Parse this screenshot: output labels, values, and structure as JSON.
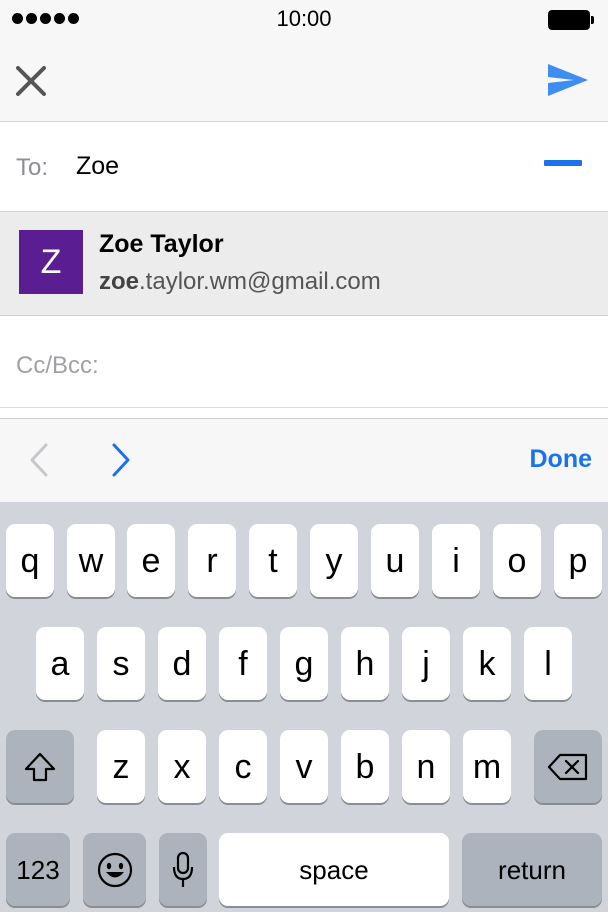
{
  "status_bar": {
    "time": "10:00"
  },
  "nav": {
    "close_icon": "close-x-icon",
    "send_icon": "send-paper-plane-icon",
    "send_color": "#3d8ef0"
  },
  "compose": {
    "to_label": "To:",
    "to_value": "Zoe",
    "cc_label": "Cc/Bcc:"
  },
  "suggestion": {
    "avatar_letter": "Z",
    "avatar_color": "#5b1d92",
    "name": "Zoe Taylor",
    "email_match": "zoe",
    "email_rest": ".taylor.wm@gmail.com"
  },
  "toolbar": {
    "done_label": "Done",
    "accent": "#1a73e8"
  },
  "keyboard": {
    "row1": [
      "q",
      "w",
      "e",
      "r",
      "t",
      "y",
      "u",
      "i",
      "o",
      "p"
    ],
    "row2": [
      "a",
      "s",
      "d",
      "f",
      "g",
      "h",
      "j",
      "k",
      "l"
    ],
    "row3": [
      "z",
      "x",
      "c",
      "v",
      "b",
      "n",
      "m"
    ],
    "numbers_label": "123",
    "space_label": "space",
    "return_label": "return"
  }
}
